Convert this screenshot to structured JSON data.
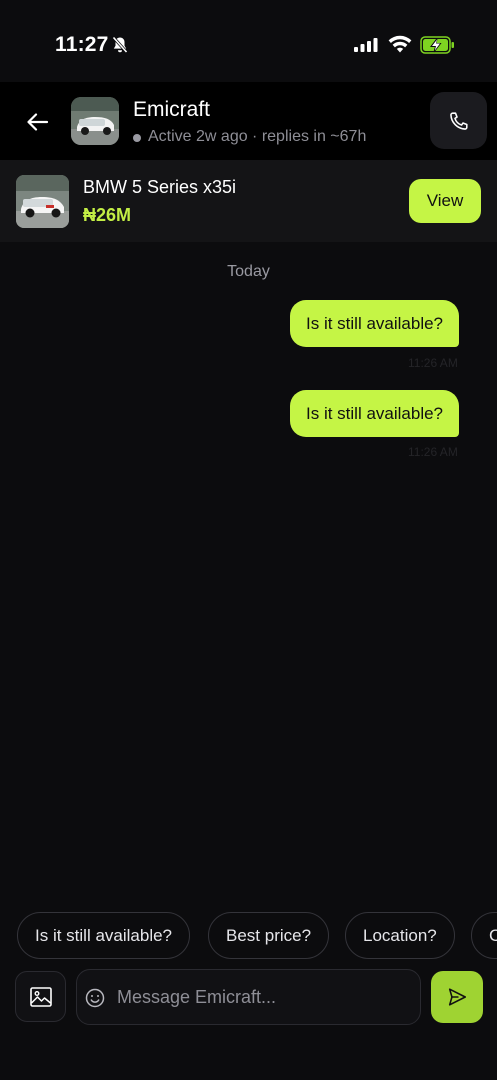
{
  "status_bar": {
    "time": "11:27"
  },
  "header": {
    "contact_name": "Emicraft",
    "contact_status": "Active 2w ago · replies in ~67h"
  },
  "listing": {
    "title": "BMW 5 Series x35i",
    "price": "₦26M",
    "view_label": "View"
  },
  "conversation": {
    "date_divider": "Today",
    "messages": [
      {
        "text": "Is it still available?",
        "time": "11:26 AM"
      },
      {
        "text": "Is it still available?",
        "time": "11:26 AM"
      }
    ]
  },
  "quick_replies": [
    "Is it still available?",
    "Best price?",
    "Location?",
    "C"
  ],
  "composer": {
    "placeholder": "Message Emicraft..."
  },
  "colors": {
    "accent": "#c5f545",
    "price": "#c3ee45",
    "background": "#0c0c0e"
  }
}
